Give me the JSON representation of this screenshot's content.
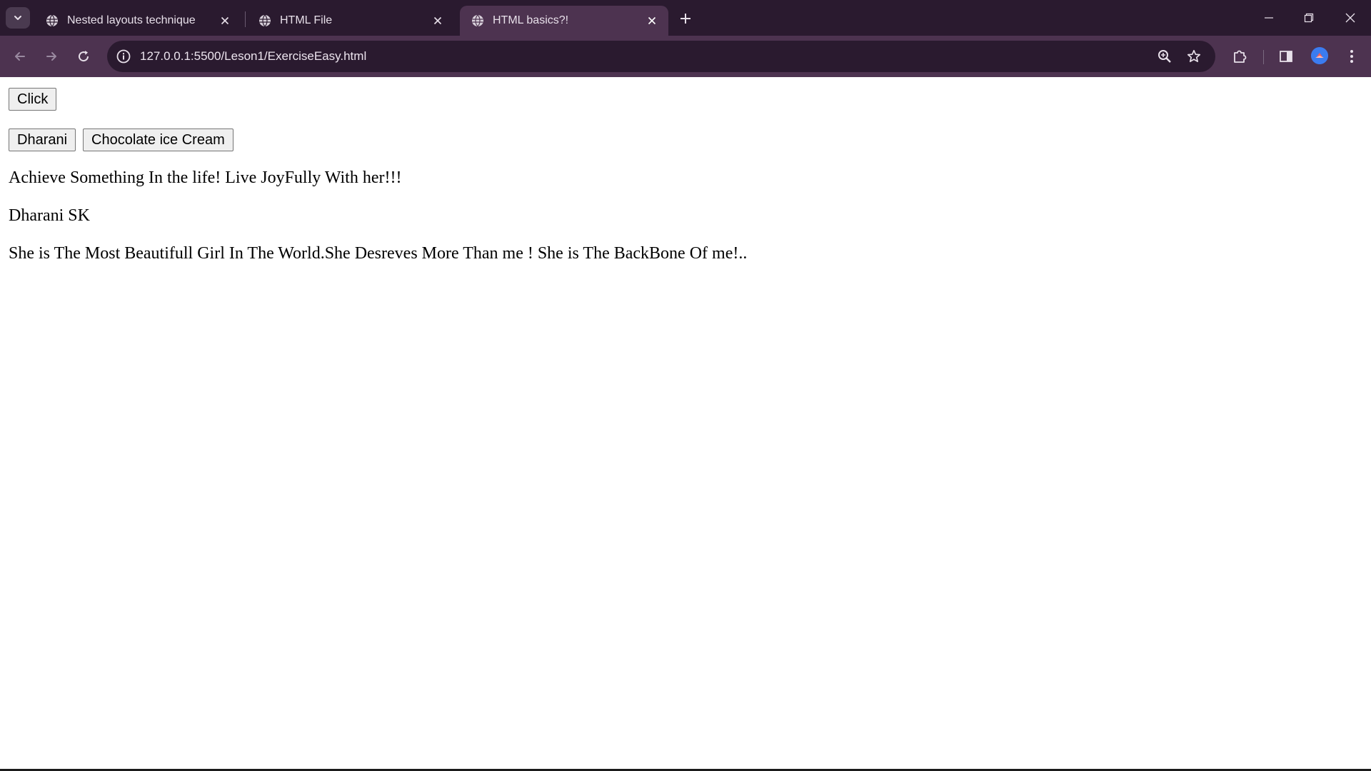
{
  "browser": {
    "tabs": [
      {
        "title": "Nested layouts technique",
        "active": false
      },
      {
        "title": "HTML File",
        "active": false
      },
      {
        "title": "HTML basics?!",
        "active": true
      }
    ],
    "url": "127.0.0.1:5500/Leson1/ExerciseEasy.html",
    "icons": {
      "tab_search": "chevron-down-icon",
      "tab_favicon": "globe-icon",
      "tab_close": "close-icon",
      "new_tab": "plus-icon",
      "back": "back-arrow-icon",
      "forward": "forward-arrow-icon",
      "reload": "reload-icon",
      "site_info": "info-icon",
      "zoom": "zoom-icon",
      "bookmark": "star-icon",
      "extensions": "puzzle-icon",
      "side_panel": "side-panel-icon",
      "profile": "avatar",
      "menu": "kebab-menu-icon",
      "minimize": "minimize-icon",
      "restore": "restore-icon",
      "close_window": "close-icon"
    },
    "colors": {
      "tabstrip": "#2a1a2f",
      "toolbar": "#4d3350",
      "omnibox": "#2a1a2f"
    }
  },
  "page": {
    "buttons": {
      "click": "Click",
      "dharani": "Dharani",
      "chocolate": "Chocolate ice Cream"
    },
    "paragraphs": [
      "Achieve Something In the life! Live JoyFully With her!!!",
      "Dharani SK",
      "She is The Most Beautifull Girl In The World.She Desreves More Than me ! She is The BackBone Of me!.."
    ]
  }
}
